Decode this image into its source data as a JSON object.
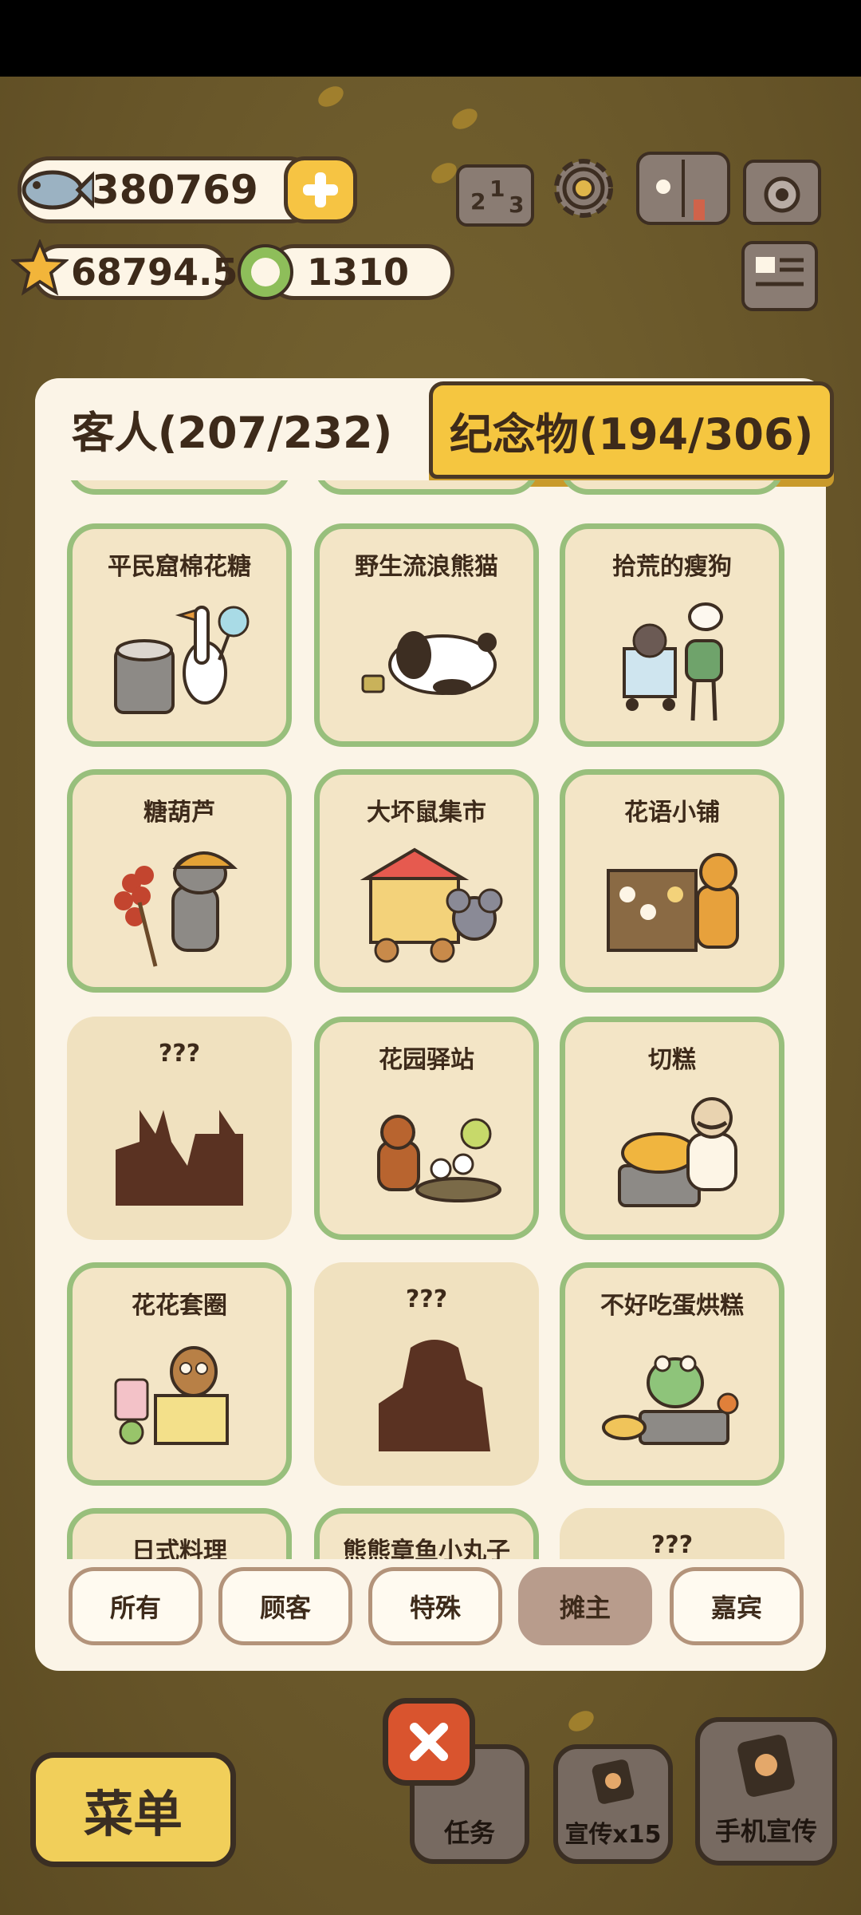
{
  "hud": {
    "fish_count": "380769",
    "star_count": "68794.5",
    "clover_count": "1310",
    "icons": [
      "fish-icon",
      "plus-icon",
      "star-icon",
      "clover-coin-icon",
      "ranking-icon",
      "gear-icon",
      "book-icon",
      "camera-icon",
      "newspaper-icon"
    ]
  },
  "tabs": {
    "guests": "客人(207/232)",
    "souvenirs": "纪念物(194/306)"
  },
  "cards": [
    {
      "name": "平民窟棉花糖",
      "locked": false
    },
    {
      "name": "野生流浪熊猫",
      "locked": false
    },
    {
      "name": "拾荒的瘦狗",
      "locked": false
    },
    {
      "name": "糖葫芦",
      "locked": false
    },
    {
      "name": "大坏鼠集市",
      "locked": false
    },
    {
      "name": "花语小铺",
      "locked": false
    },
    {
      "name": "???",
      "locked": true
    },
    {
      "name": "花园驿站",
      "locked": false
    },
    {
      "name": "切糕",
      "locked": false
    },
    {
      "name": "花花套圈",
      "locked": false
    },
    {
      "name": "???",
      "locked": true
    },
    {
      "name": "不好吃蛋烘糕",
      "locked": false
    },
    {
      "name": "日式料理",
      "locked": false
    },
    {
      "name": "熊熊章鱼小丸子",
      "locked": false
    },
    {
      "name": "???",
      "locked": true
    }
  ],
  "filters": [
    {
      "label": "所有",
      "active": false
    },
    {
      "label": "顾客",
      "active": false
    },
    {
      "label": "特殊",
      "active": false
    },
    {
      "label": "摊主",
      "active": true
    },
    {
      "label": "嘉宾",
      "active": false
    }
  ],
  "bottom": {
    "menu_label": "菜单",
    "tasks_label": "任务",
    "promo_label": "宣传x15",
    "phone_promo_label": "手机宣传"
  }
}
